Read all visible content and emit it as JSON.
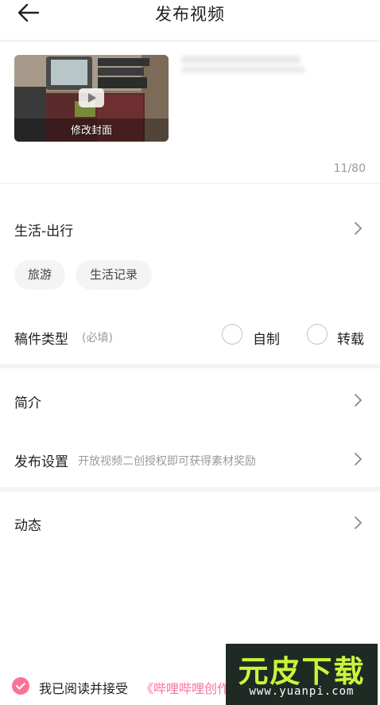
{
  "header": {
    "title": "发布视频",
    "back_icon": "arrow-left-icon"
  },
  "cover": {
    "label": "修改封面",
    "play_icon": "play-icon"
  },
  "title_field": {
    "counter": "11/80"
  },
  "category": {
    "label": "生活-出行"
  },
  "tags": [
    "旅游",
    "生活记录"
  ],
  "content_type": {
    "label": "稿件类型",
    "required_note": "(必填)",
    "options": [
      "自制",
      "转载"
    ]
  },
  "intro": {
    "label": "简介"
  },
  "publish_settings": {
    "label": "发布设置",
    "subtitle": "开放视频二创授权即可获得素材奖励"
  },
  "dynamic": {
    "label": "动态"
  },
  "agreement": {
    "text": "我已阅读并接受",
    "link": "《哔哩哔哩创作公"
  },
  "watermark": {
    "brand": "元皮下载",
    "url": "www.yuanpi.com"
  },
  "colors": {
    "accent": "#fb7299",
    "watermark_green": "#c8f53c"
  }
}
